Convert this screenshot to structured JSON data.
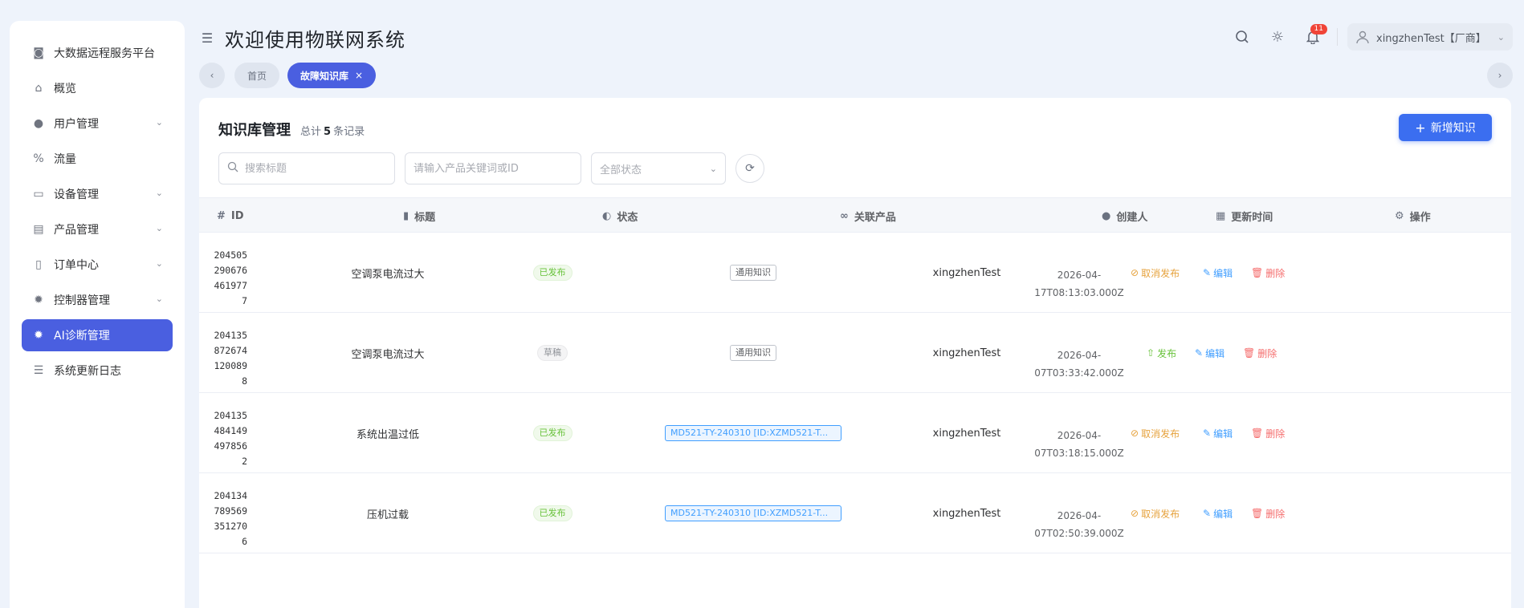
{
  "sidebar": {
    "items": [
      {
        "label": "大数据远程服务平台",
        "icon": "dashboard-icon",
        "glyph": "◙",
        "chevron": false,
        "active": false
      },
      {
        "label": "概览",
        "icon": "home-icon",
        "glyph": "⌂",
        "chevron": false,
        "active": false
      },
      {
        "label": "用户管理",
        "icon": "user-icon",
        "glyph": "●",
        "chevron": true,
        "active": false
      },
      {
        "label": "流量",
        "icon": "traffic-icon",
        "glyph": "%",
        "chevron": false,
        "active": false
      },
      {
        "label": "设备管理",
        "icon": "device-icon",
        "glyph": "▭",
        "chevron": true,
        "active": false
      },
      {
        "label": "产品管理",
        "icon": "product-icon",
        "glyph": "▤",
        "chevron": true,
        "active": false
      },
      {
        "label": "订单中心",
        "icon": "order-icon",
        "glyph": "▯",
        "chevron": true,
        "active": false
      },
      {
        "label": "控制器管理",
        "icon": "controller-icon",
        "glyph": "✹",
        "chevron": true,
        "active": false
      },
      {
        "label": "AI诊断管理",
        "icon": "ai-diagnosis-icon",
        "glyph": "✹",
        "chevron": false,
        "active": true
      },
      {
        "label": "系统更新日志",
        "icon": "changelog-icon",
        "glyph": "☰",
        "chevron": false,
        "active": false
      }
    ]
  },
  "header": {
    "title": "欢迎使用物联网系统",
    "notification_count": "11",
    "user_name": "xingzhenTest【厂商】"
  },
  "tabs": {
    "home": "首页",
    "current": "故障知识库",
    "close": "×"
  },
  "panel": {
    "title": "知识库管理",
    "count_prefix": "总计",
    "count": "5",
    "count_suffix": "条记录",
    "add_button": "新增知识",
    "search_placeholder": "搜索标题",
    "product_placeholder": "请输入产品关键词或ID",
    "status_select": "全部状态"
  },
  "table": {
    "columns": {
      "id": "ID",
      "title": "标题",
      "status": "状态",
      "product": "关联产品",
      "creator": "创建人",
      "updated": "更新时间",
      "actions": "操作"
    },
    "rows": [
      {
        "id": [
          "204505",
          "290676",
          "461977",
          "7"
        ],
        "title": "空调泵电流过大",
        "status": "已发布",
        "status_kind": "pub",
        "product": "通用知识",
        "product_kind": "gen",
        "creator": "xingzhenTest",
        "time": [
          "2026-04-",
          "17T08:13:03.000Z"
        ],
        "publish_action": "取消发布",
        "publish_kind": "unpub",
        "edit": "编辑",
        "delete": "删除"
      },
      {
        "id": [
          "204135",
          "872674",
          "120089",
          "8"
        ],
        "title": "空调泵电流过大",
        "status": "草稿",
        "status_kind": "draft",
        "product": "通用知识",
        "product_kind": "gen",
        "creator": "xingzhenTest",
        "time": [
          "2026-04-",
          "07T03:33:42.000Z"
        ],
        "publish_action": "发布",
        "publish_kind": "pubb",
        "edit": "编辑",
        "delete": "删除"
      },
      {
        "id": [
          "204135",
          "484149",
          "497856",
          "2"
        ],
        "title": "系统出温过低",
        "status": "已发布",
        "status_kind": "pub",
        "product": "MD521-TY-240310 [ID:XZMD521-T...",
        "product_kind": "prod",
        "creator": "xingzhenTest",
        "time": [
          "2026-04-",
          "07T03:18:15.000Z"
        ],
        "publish_action": "取消发布",
        "publish_kind": "unpub",
        "edit": "编辑",
        "delete": "删除"
      },
      {
        "id": [
          "204134",
          "789569",
          "351270",
          "6"
        ],
        "title": "压机过载",
        "status": "已发布",
        "status_kind": "pub",
        "product": "MD521-TY-240310 [ID:XZMD521-T...",
        "product_kind": "prod",
        "creator": "xingzhenTest",
        "time": [
          "2026-04-",
          "07T02:50:39.000Z"
        ],
        "publish_action": "取消发布",
        "publish_kind": "unpub",
        "edit": "编辑",
        "delete": "删除"
      }
    ]
  }
}
